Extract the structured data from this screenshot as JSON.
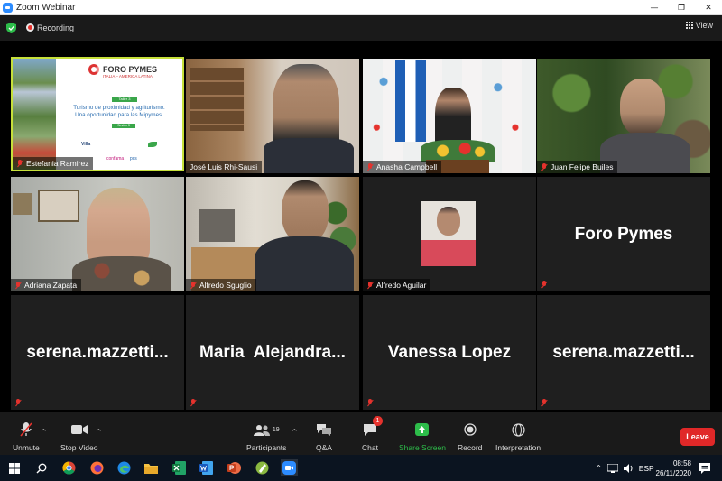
{
  "window": {
    "title": "Zoom Webinar",
    "controls": [
      "—",
      "❐",
      "✕"
    ]
  },
  "topbar": {
    "recording_label": "Recording",
    "view_label": "View"
  },
  "slide": {
    "brand": "FORO PYMES",
    "brand_sub": "ITALIA – AMERICA LATINA",
    "session_tag": "Taller 3",
    "line1": "Turismo de proximidad y agriturismo.",
    "line2": "Una oportunidad para las Mipymes.",
    "session_label": "Sesión 3",
    "sponsors": [
      "Villa",
      "confama",
      "pcs"
    ]
  },
  "participants_grid": [
    {
      "name": "Estefania Ramirez",
      "type": "slide",
      "active": true
    },
    {
      "name": "José Luis Rhi-Sausi",
      "type": "video"
    },
    {
      "name": "Anasha Campbell",
      "type": "video"
    },
    {
      "name": "Juan Felipe Builes",
      "type": "video"
    },
    {
      "name": "Adriana Zapata",
      "type": "video"
    },
    {
      "name": "Alfredo Sguglio",
      "type": "video"
    },
    {
      "name": "Alfredo Aguilar",
      "type": "photo"
    },
    {
      "name": "Foro Pymes",
      "type": "text"
    },
    {
      "name": "serena.mazzetti...",
      "type": "text"
    },
    {
      "name": "Maria  Alejandra...",
      "type": "text"
    },
    {
      "name": "Vanessa Lopez",
      "type": "text"
    },
    {
      "name": "serena.mazzetti...",
      "type": "text"
    }
  ],
  "toolbar": {
    "unmute": "Unmute",
    "stop_video": "Stop Video",
    "participants": "Participants",
    "participants_count": "19",
    "qa": "Q&A",
    "chat": "Chat",
    "chat_badge": "1",
    "share_screen": "Share Screen",
    "record": "Record",
    "interpretation": "Interpretation",
    "leave": "Leave"
  },
  "taskbar": {
    "language": "ESP",
    "time": "08:58",
    "date": "26/11/2020"
  },
  "colors": {
    "accent_green": "#2dbd4a",
    "leave_red": "#e02828",
    "active_border": "#c6e03a",
    "zoom_blue": "#2d8cff"
  }
}
